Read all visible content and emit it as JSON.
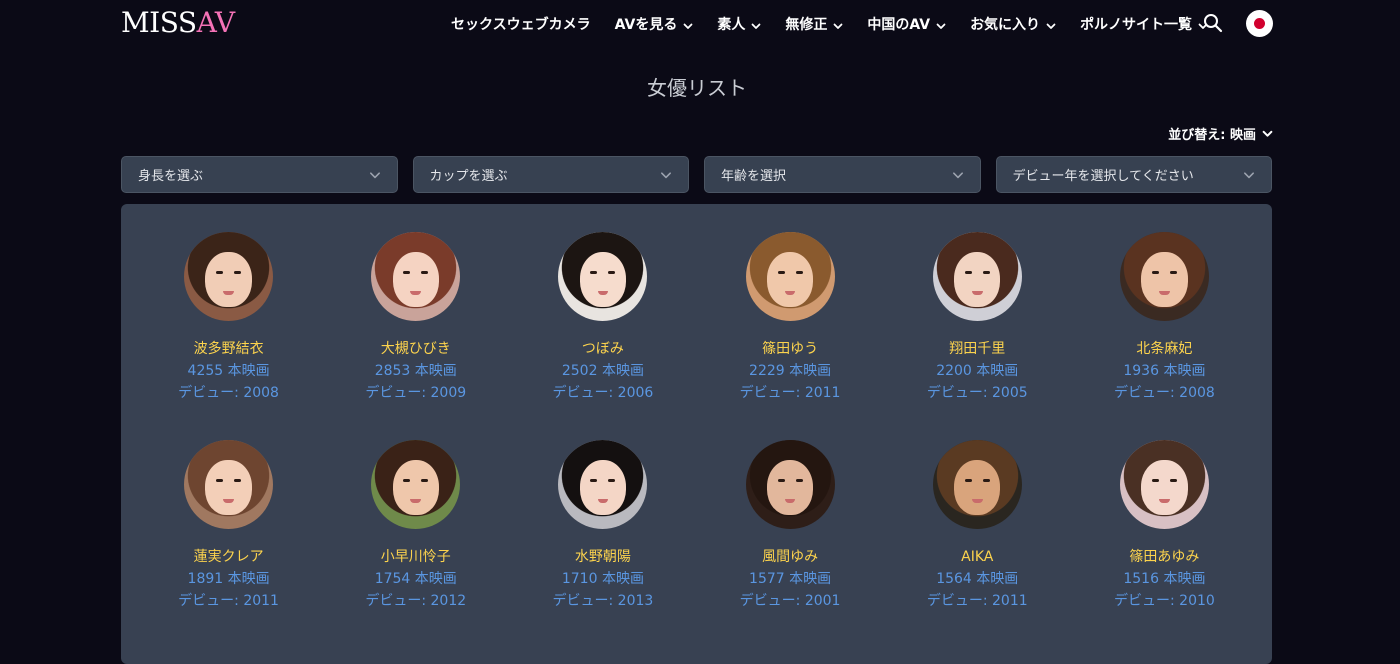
{
  "header": {
    "logo_miss": "MISS",
    "logo_av": "AV",
    "nav": [
      {
        "label": "セックスウェブカメラ",
        "has_chevron": false
      },
      {
        "label": "AVを見る",
        "has_chevron": true
      },
      {
        "label": "素人",
        "has_chevron": true
      },
      {
        "label": "無修正",
        "has_chevron": true
      },
      {
        "label": "中国のAV",
        "has_chevron": true
      },
      {
        "label": "お気に入り",
        "has_chevron": true
      },
      {
        "label": "ポルノサイト一覧",
        "has_chevron": true
      }
    ],
    "search_icon": "search-icon",
    "language_icon": "japan-flag-icon"
  },
  "page_title": "女優リスト",
  "sort": {
    "label": "並び替え: 映画"
  },
  "filters": [
    {
      "label": "身長を選ぶ"
    },
    {
      "label": "カップを選ぶ"
    },
    {
      "label": "年齢を選択"
    },
    {
      "label": "デビュー年を選択してください"
    }
  ],
  "actresses": [
    {
      "name": "波多野結衣",
      "count": "4255 本映画",
      "debut": "デビュー: 2008",
      "hair": "#3b2418",
      "skin": "#f1cdb6",
      "bg": "#8a5a44"
    },
    {
      "name": "大槻ひびき",
      "count": "2853 本映画",
      "debut": "デビュー: 2009",
      "hair": "#7a3b2a",
      "skin": "#f5d3c2",
      "bg": "#c9a39a"
    },
    {
      "name": "つぼみ",
      "count": "2502 本映画",
      "debut": "デビュー: 2006",
      "hair": "#1c1512",
      "skin": "#f6dccd",
      "bg": "#e8e4e0"
    },
    {
      "name": "篠田ゆう",
      "count": "2229 本映画",
      "debut": "デビュー: 2011",
      "hair": "#8a5a2e",
      "skin": "#f0c8aa",
      "bg": "#d09a70"
    },
    {
      "name": "翔田千里",
      "count": "2200 本映画",
      "debut": "デビュー: 2005",
      "hair": "#4a2a1e",
      "skin": "#f2d4c2",
      "bg": "#cfcfd6"
    },
    {
      "name": "北条麻妃",
      "count": "1936 本映画",
      "debut": "デビュー: 2008",
      "hair": "#5a3320",
      "skin": "#eec4a8",
      "bg": "#3a2a22"
    },
    {
      "name": "蓮実クレア",
      "count": "1891 本映画",
      "debut": "デビュー: 2011",
      "hair": "#6e4530",
      "skin": "#f3cfb8",
      "bg": "#a07860"
    },
    {
      "name": "小早川怜子",
      "count": "1754 本映画",
      "debut": "デビュー: 2012",
      "hair": "#3a2217",
      "skin": "#efc7ab",
      "bg": "#6f8a4a"
    },
    {
      "name": "水野朝陽",
      "count": "1710 本映画",
      "debut": "デビュー: 2013",
      "hair": "#141010",
      "skin": "#f4d6c6",
      "bg": "#b9b9bf"
    },
    {
      "name": "風間ゆみ",
      "count": "1577 本映画",
      "debut": "デビュー: 2001",
      "hair": "#241610",
      "skin": "#e2b79c",
      "bg": "#2e1e18"
    },
    {
      "name": "AIKA",
      "count": "1564 本映画",
      "debut": "デビュー: 2011",
      "hair": "#5a3a22",
      "skin": "#d9a47c",
      "bg": "#2a2620"
    },
    {
      "name": "篠田あゆみ",
      "count": "1516 本映画",
      "debut": "デビュー: 2010",
      "hair": "#4a3024",
      "skin": "#f4d8cc",
      "bg": "#d8c0c4"
    }
  ]
}
